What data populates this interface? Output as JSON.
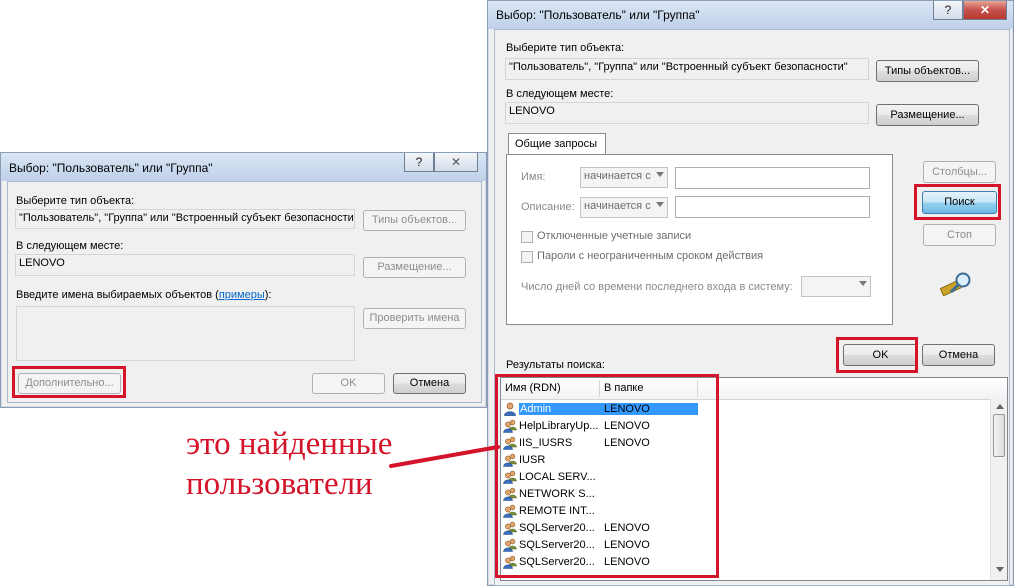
{
  "left_dialog": {
    "title": "Выбор: \"Пользователь\" или \"Группа\"",
    "help_glyph": "?",
    "close_glyph": "✕",
    "object_type_label": "Выберите тип объекта:",
    "object_type_value": "\"Пользователь\", \"Группа\" или \"Встроенный субъект безопасности\"",
    "object_types_button": "Типы объектов...",
    "location_label": "В следующем месте:",
    "location_value": "LENOVO",
    "location_button": "Размещение...",
    "names_label_prefix": "Введите имена выбираемых объектов (",
    "names_label_link": "примеры",
    "names_label_suffix": "):",
    "check_names_button": "Проверить имена",
    "advanced_button": "Дополнительно...",
    "ok_button": "OK",
    "cancel_button": "Отмена"
  },
  "right_dialog": {
    "title": "Выбор: \"Пользователь\" или \"Группа\"",
    "help_glyph": "?",
    "close_glyph": "✕",
    "object_type_label": "Выберите тип объекта:",
    "object_type_value": "\"Пользователь\", \"Группа\" или \"Встроенный субъект безопасности\"",
    "object_types_button": "Типы объектов...",
    "location_label": "В следующем месте:",
    "location_value": "LENOVO",
    "location_button": "Размещение...",
    "tab_label": "Общие запросы",
    "name_label": "Имя:",
    "name_combo": "начинается с",
    "description_label": "Описание:",
    "description_combo": "начинается с",
    "disabled_accounts_label": "Отключенные учетные записи",
    "non_expiring_label": "Пароли с неограниченным сроком действия",
    "days_since_logon_label": "Число дней со времени последнего входа в систему:",
    "columns_button": "Столбцы...",
    "search_button": "Поиск",
    "stop_button": "Стоп",
    "ok_button": "OK",
    "cancel_button": "Отмена",
    "results_label": "Результаты поиска:",
    "results_columns": [
      "Имя (RDN)",
      "В папке"
    ],
    "results": [
      {
        "name": "Admin",
        "folder": "LENOVO",
        "icon": "user-icon"
      },
      {
        "name": "HelpLibraryUp...",
        "folder": "LENOVO",
        "icon": "group-icon"
      },
      {
        "name": "IIS_IUSRS",
        "folder": "LENOVO",
        "icon": "group-icon"
      },
      {
        "name": "IUSR",
        "folder": "",
        "icon": "group-icon"
      },
      {
        "name": "LOCAL SERV...",
        "folder": "",
        "icon": "group-icon"
      },
      {
        "name": "NETWORK S...",
        "folder": "",
        "icon": "group-icon"
      },
      {
        "name": "REMOTE INT...",
        "folder": "",
        "icon": "group-icon"
      },
      {
        "name": "SQLServer20...",
        "folder": "LENOVO",
        "icon": "group-icon"
      },
      {
        "name": "SQLServer20...",
        "folder": "LENOVO",
        "icon": "group-icon"
      },
      {
        "name": "SQLServer20...",
        "folder": "LENOVO",
        "icon": "group-icon"
      }
    ]
  },
  "annotation": {
    "line1": "это найденные",
    "line2": "пользователи",
    "color": "#d4142a"
  }
}
